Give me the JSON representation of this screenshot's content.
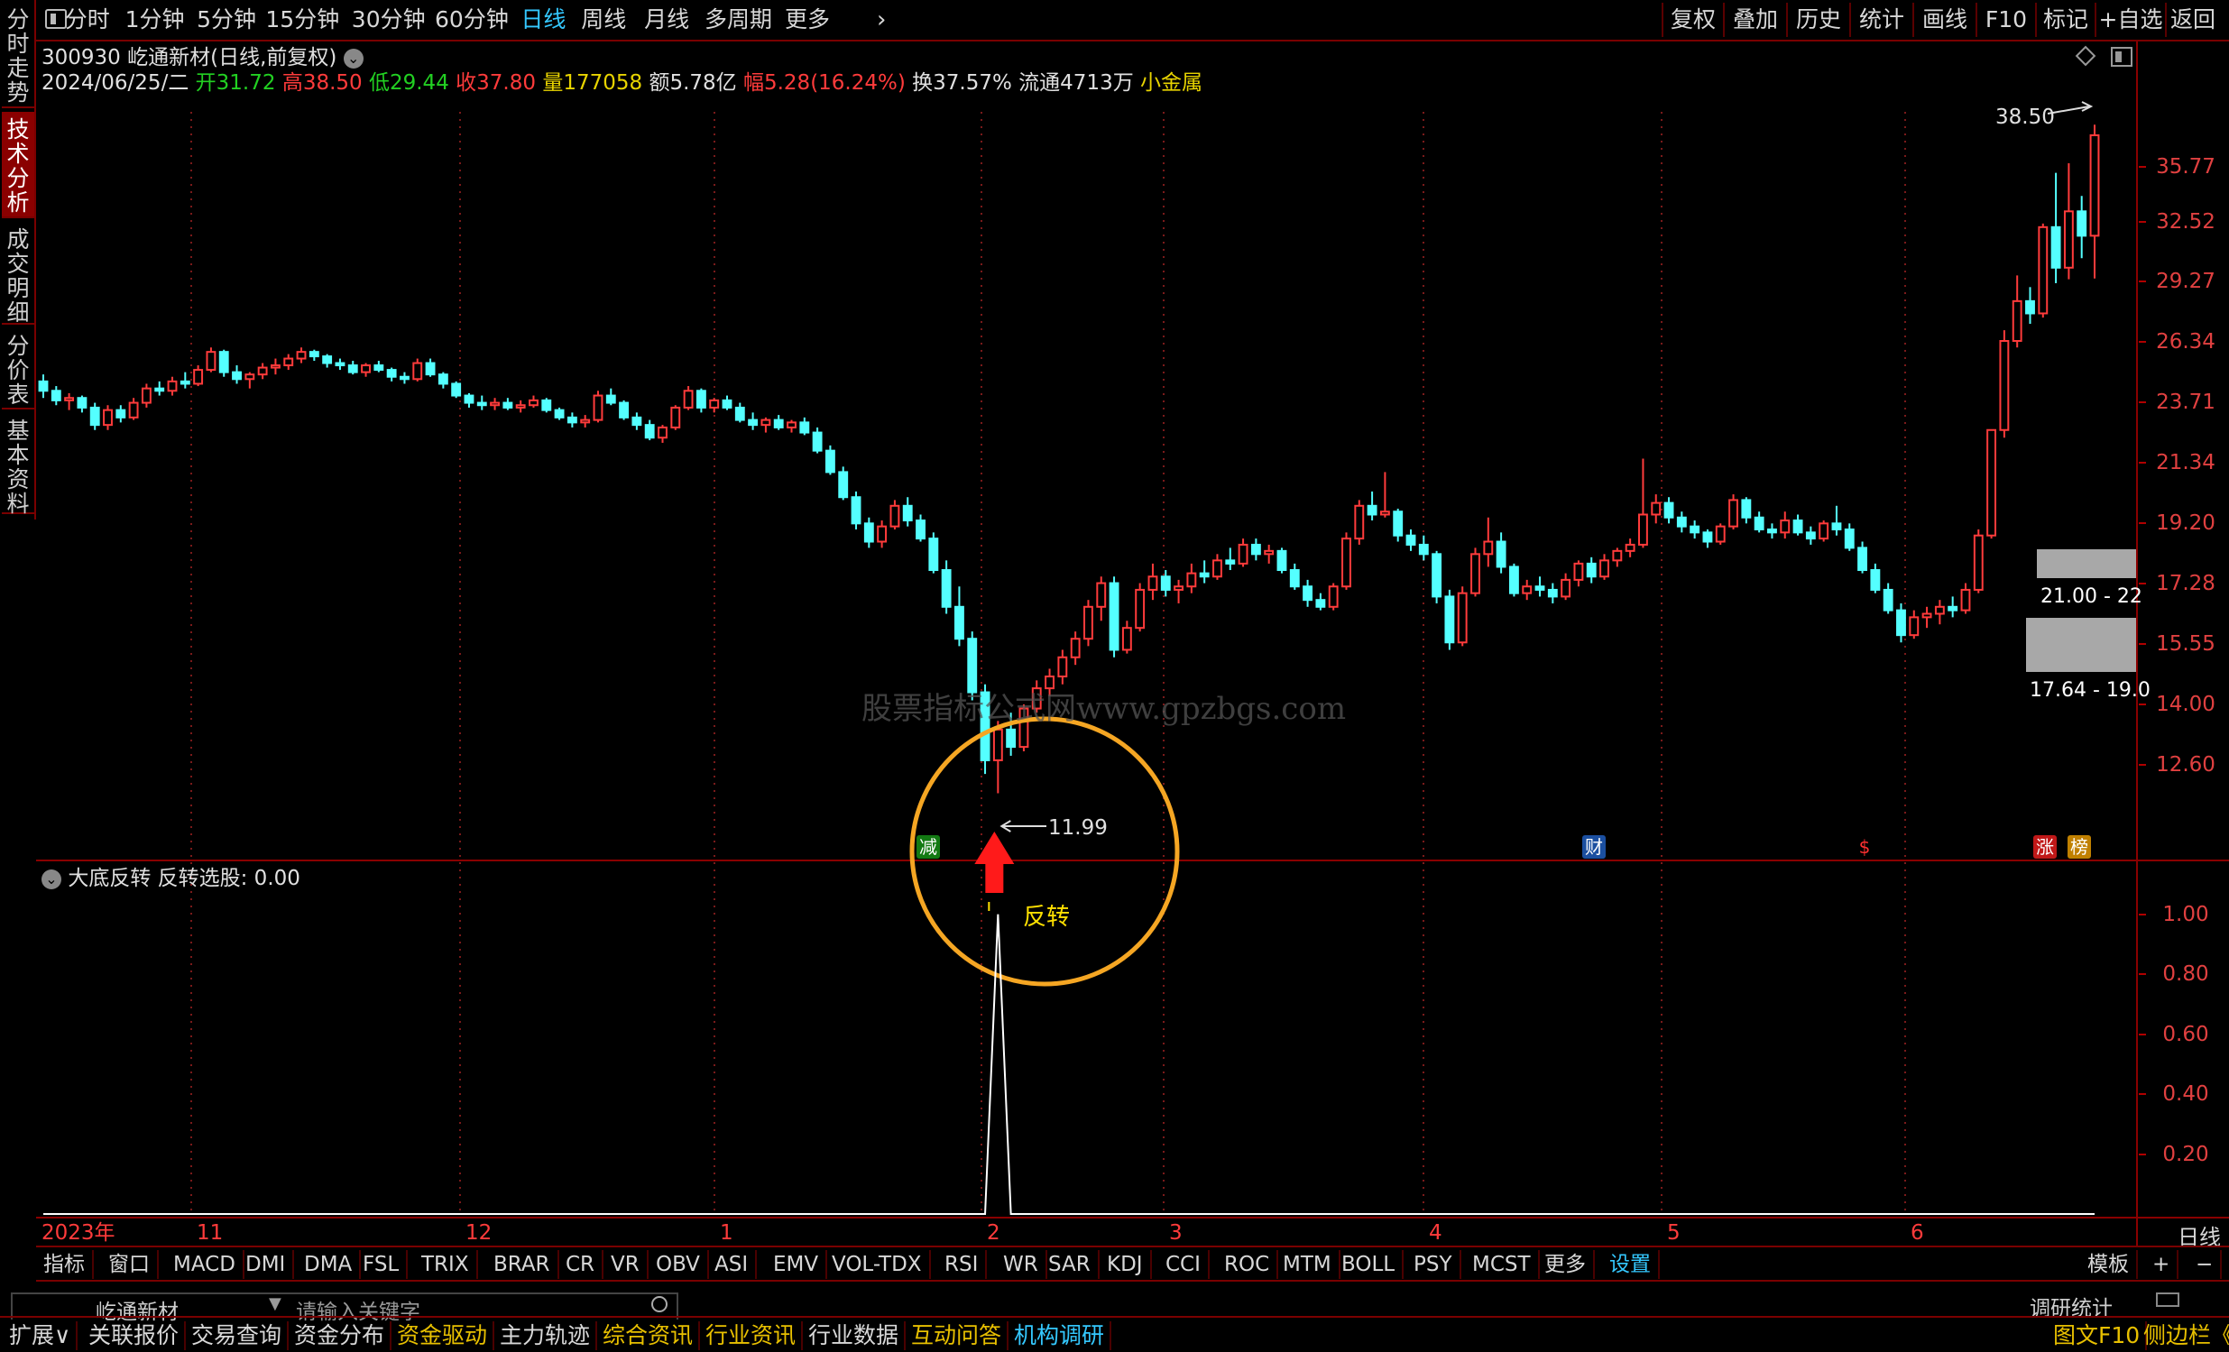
{
  "toolbar": {
    "periods": [
      "分时",
      "1分钟",
      "5分钟",
      "15分钟",
      "30分钟",
      "60分钟",
      "日线",
      "周线",
      "月线",
      "多周期",
      "更多"
    ],
    "active_period": "日线",
    "right_buttons": [
      "复权",
      "叠加",
      "历史",
      "统计",
      "画线",
      "F10",
      "标记",
      "+自选",
      "返回"
    ]
  },
  "left_tabs": [
    "分时走势",
    "技术分析",
    "成交明细",
    "分价表",
    "基本资料"
  ],
  "stock": {
    "code_name": "300930 屹通新材(日线,前复权)",
    "date": "2024/06/25/二",
    "open_label": "开",
    "open": "31.72",
    "high_label": "高",
    "high": "38.50",
    "low_label": "低",
    "low": "29.44",
    "close_label": "收",
    "close": "37.80",
    "vol_label": "量",
    "vol": "177058",
    "amount_label": "额",
    "amount": "5.78亿",
    "change_label": "幅",
    "change": "5.28(16.24%)",
    "turnover": "换37.57%",
    "float": "流通4713万",
    "sector": "小金属"
  },
  "price_axis": [
    "35.77",
    "32.52",
    "29.27",
    "26.34",
    "23.71",
    "21.34",
    "19.20",
    "17.28",
    "15.55",
    "14.00",
    "12.60"
  ],
  "indicator_axis": [
    "1.00",
    "0.80",
    "0.60",
    "0.40",
    "0.20"
  ],
  "date_axis": [
    "2023年",
    "11",
    "12",
    "1",
    "2",
    "3",
    "4",
    "5",
    "6"
  ],
  "annotations": {
    "high_marker": "38.50",
    "low_marker": "11.99",
    "zone_upper": "21.00 - 22",
    "zone_lower": "17.64 - 19.0",
    "watermark": "股票指标公式网www.gpzbgs.com",
    "signal_text": "反转",
    "event_tags": [
      "减",
      "财",
      "$",
      "涨",
      "榜"
    ]
  },
  "indicator_panel": {
    "name": "大底反转",
    "value_text": "反转选股: 0.00"
  },
  "chart_data": {
    "type": "candlestick",
    "title": "300930 屹通新材(日线,前复权)",
    "ylim": [
      11.5,
      39.5
    ],
    "y_scale": "log",
    "x_range": [
      "2023-10",
      "2024-06-25"
    ],
    "candles_ohlc": [
      [
        24.6,
        24.9,
        23.9,
        24.2
      ],
      [
        24.2,
        24.4,
        23.6,
        23.8
      ],
      [
        23.8,
        24.1,
        23.4,
        23.9
      ],
      [
        23.9,
        24.0,
        23.3,
        23.5
      ],
      [
        23.5,
        23.7,
        22.6,
        22.8
      ],
      [
        22.8,
        23.6,
        22.6,
        23.4
      ],
      [
        23.4,
        23.6,
        22.9,
        23.1
      ],
      [
        23.1,
        23.9,
        23.0,
        23.7
      ],
      [
        23.7,
        24.5,
        23.5,
        24.3
      ],
      [
        24.3,
        24.6,
        24.0,
        24.2
      ],
      [
        24.2,
        24.8,
        24.0,
        24.6
      ],
      [
        24.6,
        25.0,
        24.3,
        24.5
      ],
      [
        24.5,
        25.3,
        24.4,
        25.1
      ],
      [
        25.1,
        26.1,
        25.0,
        25.9
      ],
      [
        25.9,
        26.0,
        24.8,
        25.0
      ],
      [
        25.0,
        25.3,
        24.5,
        24.7
      ],
      [
        24.7,
        25.0,
        24.3,
        24.9
      ],
      [
        24.9,
        25.4,
        24.7,
        25.2
      ],
      [
        25.2,
        25.6,
        24.9,
        25.3
      ],
      [
        25.3,
        25.8,
        25.1,
        25.6
      ],
      [
        25.6,
        26.1,
        25.4,
        25.9
      ],
      [
        25.9,
        26.0,
        25.5,
        25.7
      ],
      [
        25.7,
        25.8,
        25.2,
        25.4
      ],
      [
        25.4,
        25.6,
        25.1,
        25.3
      ],
      [
        25.3,
        25.5,
        24.9,
        25.0
      ],
      [
        25.0,
        25.4,
        24.8,
        25.3
      ],
      [
        25.3,
        25.5,
        25.0,
        25.1
      ],
      [
        25.1,
        25.2,
        24.6,
        24.8
      ],
      [
        24.8,
        25.0,
        24.5,
        24.7
      ],
      [
        24.7,
        25.6,
        24.6,
        25.4
      ],
      [
        25.4,
        25.6,
        24.8,
        24.9
      ],
      [
        24.9,
        25.0,
        24.3,
        24.5
      ],
      [
        24.5,
        24.6,
        23.9,
        24.0
      ],
      [
        24.0,
        24.1,
        23.5,
        23.7
      ],
      [
        23.7,
        24.0,
        23.4,
        23.6
      ],
      [
        23.6,
        23.9,
        23.4,
        23.7
      ],
      [
        23.7,
        23.9,
        23.4,
        23.5
      ],
      [
        23.5,
        23.8,
        23.3,
        23.6
      ],
      [
        23.6,
        24.0,
        23.5,
        23.8
      ],
      [
        23.8,
        23.9,
        23.3,
        23.4
      ],
      [
        23.4,
        23.5,
        23.0,
        23.1
      ],
      [
        23.1,
        23.3,
        22.7,
        22.9
      ],
      [
        22.9,
        23.2,
        22.7,
        23.0
      ],
      [
        23.0,
        24.2,
        22.9,
        24.0
      ],
      [
        24.0,
        24.3,
        23.6,
        23.7
      ],
      [
        23.7,
        23.8,
        23.0,
        23.1
      ],
      [
        23.1,
        23.3,
        22.6,
        22.8
      ],
      [
        22.8,
        23.0,
        22.2,
        22.3
      ],
      [
        22.3,
        22.8,
        22.1,
        22.7
      ],
      [
        22.7,
        23.6,
        22.6,
        23.5
      ],
      [
        23.5,
        24.4,
        23.4,
        24.2
      ],
      [
        24.2,
        24.3,
        23.3,
        23.5
      ],
      [
        23.5,
        23.9,
        23.3,
        23.8
      ],
      [
        23.8,
        24.0,
        23.4,
        23.5
      ],
      [
        23.5,
        23.7,
        22.9,
        23.0
      ],
      [
        23.0,
        23.3,
        22.6,
        22.8
      ],
      [
        22.8,
        23.1,
        22.5,
        23.0
      ],
      [
        23.0,
        23.2,
        22.6,
        22.7
      ],
      [
        22.7,
        23.0,
        22.5,
        22.9
      ],
      [
        22.9,
        23.1,
        22.4,
        22.5
      ],
      [
        22.5,
        22.7,
        21.7,
        21.8
      ],
      [
        21.8,
        22.0,
        20.9,
        21.0
      ],
      [
        21.0,
        21.2,
        20.0,
        20.1
      ],
      [
        20.1,
        20.3,
        19.0,
        19.2
      ],
      [
        19.2,
        19.4,
        18.4,
        18.6
      ],
      [
        18.6,
        19.3,
        18.4,
        19.1
      ],
      [
        19.1,
        20.0,
        19.0,
        19.8
      ],
      [
        19.8,
        20.1,
        19.1,
        19.3
      ],
      [
        19.3,
        19.5,
        18.6,
        18.7
      ],
      [
        18.7,
        18.9,
        17.6,
        17.7
      ],
      [
        17.7,
        18.0,
        16.4,
        16.6
      ],
      [
        16.6,
        17.2,
        15.5,
        15.7
      ],
      [
        15.7,
        15.9,
        14.1,
        14.3
      ],
      [
        14.3,
        14.5,
        12.4,
        12.7
      ],
      [
        12.7,
        13.6,
        11.99,
        13.4
      ],
      [
        13.4,
        13.8,
        12.8,
        13.0
      ],
      [
        13.0,
        14.0,
        12.9,
        13.9
      ],
      [
        13.9,
        14.6,
        13.8,
        14.4
      ],
      [
        14.4,
        14.9,
        14.2,
        14.7
      ],
      [
        14.7,
        15.4,
        14.5,
        15.2
      ],
      [
        15.2,
        15.9,
        15.0,
        15.7
      ],
      [
        15.7,
        16.8,
        15.5,
        16.6
      ],
      [
        16.6,
        17.5,
        16.2,
        17.3
      ],
      [
        17.3,
        17.5,
        15.2,
        15.4
      ],
      [
        15.4,
        16.2,
        15.3,
        16.0
      ],
      [
        16.0,
        17.3,
        15.9,
        17.1
      ],
      [
        17.1,
        17.9,
        16.8,
        17.5
      ],
      [
        17.5,
        17.7,
        16.9,
        17.1
      ],
      [
        17.1,
        17.4,
        16.7,
        17.2
      ],
      [
        17.2,
        17.9,
        17.0,
        17.6
      ],
      [
        17.6,
        18.0,
        17.3,
        17.5
      ],
      [
        17.5,
        18.2,
        17.4,
        18.0
      ],
      [
        18.0,
        18.4,
        17.7,
        17.9
      ],
      [
        17.9,
        18.7,
        17.8,
        18.5
      ],
      [
        18.5,
        18.7,
        18.0,
        18.2
      ],
      [
        18.2,
        18.5,
        17.9,
        18.3
      ],
      [
        18.3,
        18.4,
        17.6,
        17.7
      ],
      [
        17.7,
        17.9,
        17.1,
        17.2
      ],
      [
        17.2,
        17.4,
        16.6,
        16.8
      ],
      [
        16.8,
        17.0,
        16.5,
        16.6
      ],
      [
        16.6,
        17.3,
        16.5,
        17.2
      ],
      [
        17.2,
        18.9,
        17.1,
        18.7
      ],
      [
        18.7,
        20.0,
        18.5,
        19.8
      ],
      [
        19.8,
        20.3,
        19.3,
        19.5
      ],
      [
        19.5,
        21.0,
        19.4,
        19.6
      ],
      [
        19.6,
        19.7,
        18.6,
        18.8
      ],
      [
        18.8,
        19.0,
        18.3,
        18.5
      ],
      [
        18.5,
        18.8,
        18.0,
        18.2
      ],
      [
        18.2,
        18.3,
        16.7,
        16.9
      ],
      [
        16.9,
        17.1,
        15.4,
        15.6
      ],
      [
        15.6,
        17.2,
        15.5,
        17.0
      ],
      [
        17.0,
        18.4,
        16.9,
        18.2
      ],
      [
        18.2,
        19.4,
        17.8,
        18.6
      ],
      [
        18.6,
        18.9,
        17.6,
        17.8
      ],
      [
        17.8,
        17.9,
        16.9,
        17.0
      ],
      [
        17.0,
        17.4,
        16.8,
        17.2
      ],
      [
        17.2,
        17.5,
        16.9,
        17.1
      ],
      [
        17.1,
        17.3,
        16.7,
        16.9
      ],
      [
        16.9,
        17.6,
        16.8,
        17.4
      ],
      [
        17.4,
        18.0,
        17.2,
        17.9
      ],
      [
        17.9,
        18.1,
        17.3,
        17.5
      ],
      [
        17.5,
        18.2,
        17.4,
        18.0
      ],
      [
        18.0,
        18.4,
        17.8,
        18.3
      ],
      [
        18.3,
        18.7,
        18.1,
        18.5
      ],
      [
        18.5,
        21.5,
        18.4,
        19.5
      ],
      [
        19.5,
        20.2,
        19.2,
        19.9
      ],
      [
        19.9,
        20.1,
        19.2,
        19.4
      ],
      [
        19.4,
        19.6,
        18.9,
        19.1
      ],
      [
        19.1,
        19.3,
        18.7,
        18.9
      ],
      [
        18.9,
        19.0,
        18.4,
        18.6
      ],
      [
        18.6,
        19.2,
        18.5,
        19.1
      ],
      [
        19.1,
        20.2,
        19.0,
        20.0
      ],
      [
        20.0,
        20.1,
        19.2,
        19.4
      ],
      [
        19.4,
        19.6,
        18.9,
        19.0
      ],
      [
        19.0,
        19.2,
        18.7,
        18.9
      ],
      [
        18.9,
        19.6,
        18.7,
        19.3
      ],
      [
        19.3,
        19.5,
        18.8,
        18.9
      ],
      [
        18.9,
        19.1,
        18.5,
        18.7
      ],
      [
        18.7,
        19.3,
        18.6,
        19.2
      ],
      [
        19.2,
        19.8,
        18.8,
        19.0
      ],
      [
        19.0,
        19.2,
        18.3,
        18.4
      ],
      [
        18.4,
        18.6,
        17.6,
        17.7
      ],
      [
        17.7,
        17.9,
        17.0,
        17.1
      ],
      [
        17.1,
        17.3,
        16.4,
        16.5
      ],
      [
        16.5,
        16.7,
        15.6,
        15.8
      ],
      [
        15.8,
        16.5,
        15.7,
        16.3
      ],
      [
        16.3,
        16.6,
        16.0,
        16.4
      ],
      [
        16.4,
        16.8,
        16.1,
        16.6
      ],
      [
        16.6,
        16.9,
        16.3,
        16.5
      ],
      [
        16.5,
        17.3,
        16.4,
        17.1
      ],
      [
        17.1,
        19.0,
        17.0,
        18.8
      ],
      [
        18.8,
        22.6,
        18.7,
        22.6
      ],
      [
        22.6,
        26.9,
        22.3,
        26.4
      ],
      [
        26.4,
        29.6,
        26.1,
        28.3
      ],
      [
        28.3,
        29.0,
        27.2,
        27.7
      ],
      [
        27.7,
        32.4,
        27.5,
        32.2
      ],
      [
        32.2,
        35.4,
        29.2,
        30.0
      ],
      [
        30.0,
        36.0,
        29.4,
        33.1
      ],
      [
        33.1,
        34.0,
        30.5,
        31.72
      ],
      [
        31.72,
        38.5,
        29.44,
        37.8
      ]
    ],
    "indicator": {
      "name": "大底反转",
      "signal_index": 74,
      "ylim": [
        0,
        1.05
      ]
    }
  }
}
